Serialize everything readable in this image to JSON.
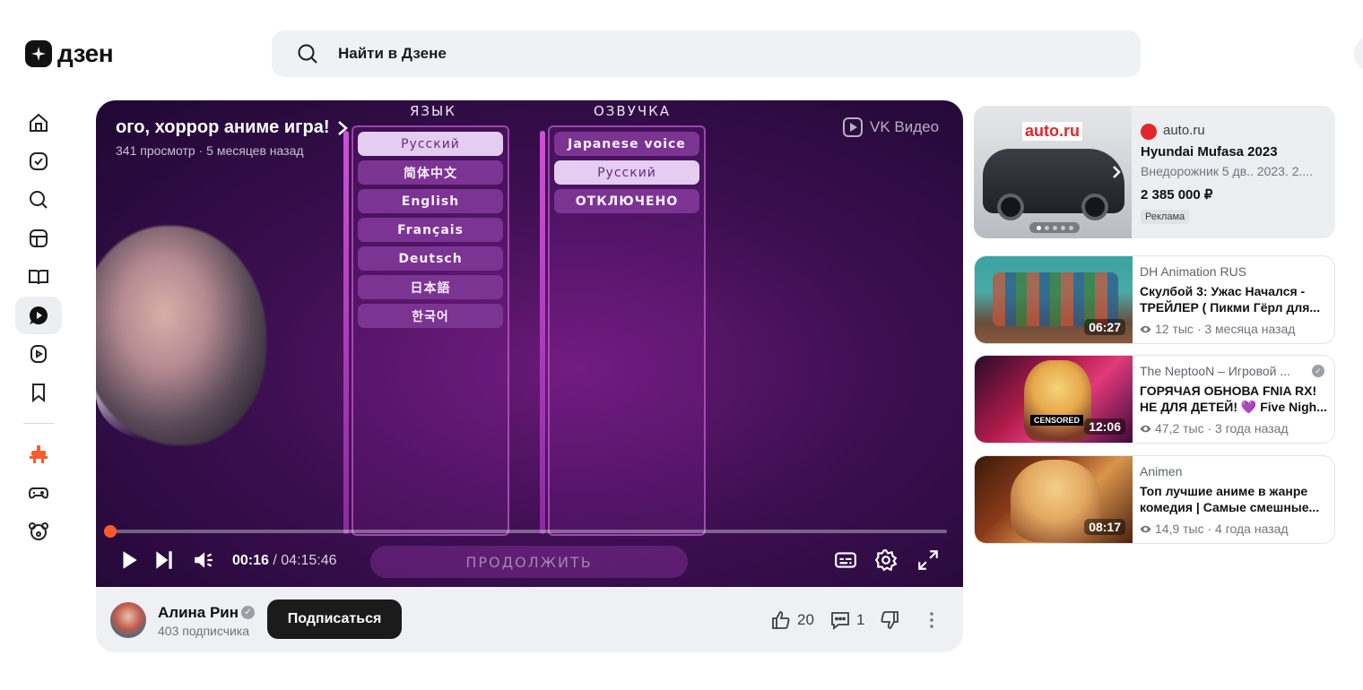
{
  "header": {
    "logo_text": "дзен",
    "search_placeholder": "Найти в Дзене"
  },
  "sidebar": {
    "items": [
      {
        "name": "home",
        "icon": "home-icon"
      },
      {
        "name": "subscriptions",
        "icon": "subscriptions-icon"
      },
      {
        "name": "search",
        "icon": "search-icon"
      },
      {
        "name": "showcase",
        "icon": "showcase-icon"
      },
      {
        "name": "articles",
        "icon": "book-icon"
      },
      {
        "name": "videos",
        "icon": "video-icon",
        "active": true
      },
      {
        "name": "shorts",
        "icon": "shorts-icon"
      },
      {
        "name": "bookmarks",
        "icon": "bookmark-icon"
      },
      {
        "name": "promo",
        "icon": "promo-icon"
      },
      {
        "name": "games",
        "icon": "gamepad-icon"
      },
      {
        "name": "kids",
        "icon": "bear-icon"
      }
    ]
  },
  "video": {
    "title": "ого, хоррор аниме игра!",
    "meta": "341 просмотр · 5 месяцев назад",
    "provider": "VK Видео",
    "game_menu": {
      "language_heading": "ЯЗЫК",
      "voice_heading": "ОЗВУЧКА",
      "languages": [
        "Русский",
        "简体中文",
        "English",
        "Français",
        "Deutsch",
        "日本語",
        "한국어"
      ],
      "selected_language": 0,
      "voices": [
        "Japanese voice",
        "Русский",
        "ОТКЛЮЧЕНО"
      ],
      "selected_voice": 1,
      "continue_label": "ПРОДОЛЖИТЬ"
    },
    "current_time": "00:16",
    "duration": "04:15:46",
    "progress": 0.001
  },
  "author": {
    "name": "Алина Рин",
    "subscribers": "403 подписчика",
    "subscribe_label": "Подписаться",
    "likes": "20",
    "comments": "1"
  },
  "ad": {
    "image_brand": "auto.ru",
    "source": "auto.ru",
    "title": "Hyundai Mufasa 2023",
    "description": "Внедорожник 5 дв.. 2023. 2....",
    "price": "2 385 000 ₽",
    "tag": "Реклама"
  },
  "recommendations": [
    {
      "channel": "DH Animation RUS",
      "title": "Скулбой 3: Ужас Начался - ТРЕЙЛЕР ( Пикми Гёрл для...",
      "stats": "12 тыс · 3 месяца назад",
      "duration": "06:27",
      "verified": false
    },
    {
      "channel": "The NeptooN – Игровой ...",
      "title": "ГОРЯЧАЯ ОБНОВА FNIA RX! НЕ ДЛЯ ДЕТЕЙ! 💜 Five Nigh...",
      "stats": "47,2 тыс · 3 года назад",
      "duration": "12:06",
      "verified": true,
      "badge": "CENSORED"
    },
    {
      "channel": "Animen",
      "title": "Топ лучшие аниме в жанре комедия | Самые смешные...",
      "stats": "14,9 тыс · 4 года назад",
      "duration": "08:17",
      "verified": false
    }
  ],
  "colors": {
    "accent": "#ff5a2a",
    "subscribe_bg": "#1b1b1b",
    "menu_selected": "#e4cdf0"
  }
}
